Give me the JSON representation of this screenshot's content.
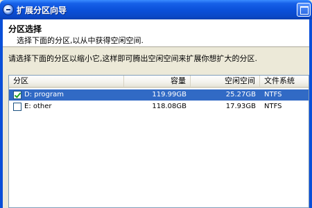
{
  "window": {
    "title": "扩展分区向导"
  },
  "header": {
    "title": "分区选择",
    "subtitle": "选择下面的分区,以从中获得空闲空间."
  },
  "instruction": "请选择下面的分区以缩小它,这样即可腾出空闲空间来扩展你想扩大的分区.",
  "table": {
    "columns": [
      "分区",
      "容量",
      "空闲空间",
      "文件系统"
    ],
    "rows": [
      {
        "checked": true,
        "selected": true,
        "name": "D: program",
        "capacity": "119.99GB",
        "free": "25.27GB",
        "fs": "NTFS"
      },
      {
        "checked": false,
        "selected": false,
        "name": "E: other",
        "capacity": "118.08GB",
        "free": "17.93GB",
        "fs": "NTFS"
      }
    ]
  },
  "colors": {
    "titlebar": "#0a4fd8",
    "selection": "#316ac5",
    "dialog_bg": "#ece9d8"
  },
  "icons": {
    "app": "partition-wizard-icon",
    "restore": "restore-icon"
  }
}
